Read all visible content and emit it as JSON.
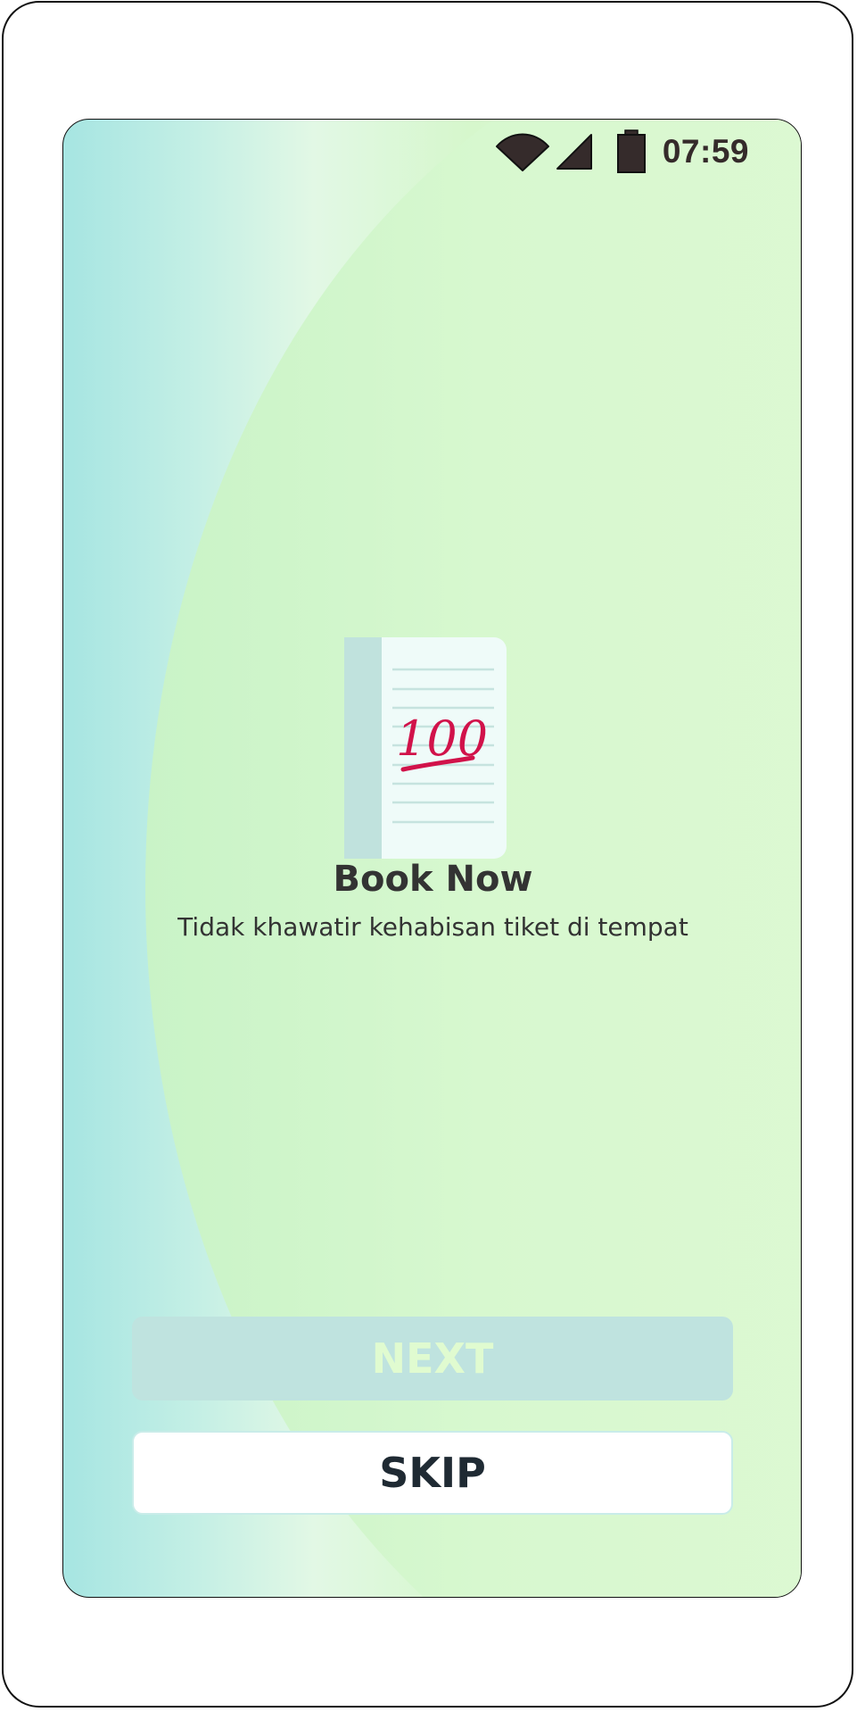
{
  "status_bar": {
    "time": "07:59",
    "icons": [
      "wifi-icon",
      "signal-icon",
      "battery-icon"
    ]
  },
  "onboarding": {
    "illustration_icon": "notebook-hundred-icon",
    "illustration_text": "100",
    "title": "Book Now",
    "subtitle": "Tidak khawatir kehabisan tiket di tempat"
  },
  "buttons": {
    "next_label": "NEXT",
    "skip_label": "SKIP"
  },
  "colors": {
    "gradient_left": "#a6e5e2",
    "gradient_right": "#e5f9dc",
    "next_button_bg": "#bfe3df",
    "next_button_text": "#e0fbd0",
    "skip_button_border": "#c9ece9",
    "accent_red": "#d1124a"
  }
}
